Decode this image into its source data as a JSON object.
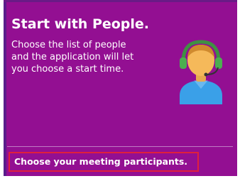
{
  "tile": {
    "title": "Start with People.",
    "description_lines": [
      "Choose the list of people",
      "and the application will let",
      "you choose a start time."
    ],
    "icon": "person-with-headset-icon",
    "action_label": "Choose your meeting participants."
  },
  "colors": {
    "tile_background": "#930f92",
    "highlight_border": "#e0203c"
  }
}
